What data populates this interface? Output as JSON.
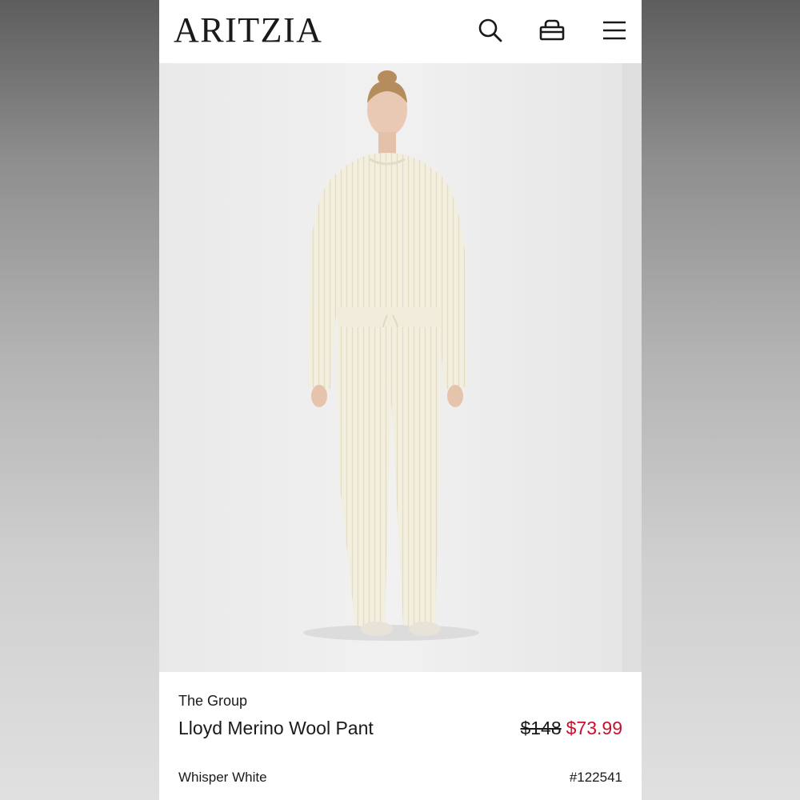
{
  "header": {
    "logo": "ARITZIA",
    "icons": [
      "search-icon",
      "shopping-bag-icon",
      "hamburger-menu-icon"
    ]
  },
  "hero": {
    "image": "model-in-cream-ribbed-sweater-and-wide-leg-pant"
  },
  "product": {
    "brand": "The Group",
    "name": "Lloyd Merino Wool Pant",
    "price_original": "$148",
    "price_sale": "$73.99",
    "color": "Whisper White",
    "style_number": "#122541"
  },
  "colors": {
    "sale_price": "#c8102e",
    "garment": "#f3efdf",
    "photo_background": "#ebebeb"
  }
}
